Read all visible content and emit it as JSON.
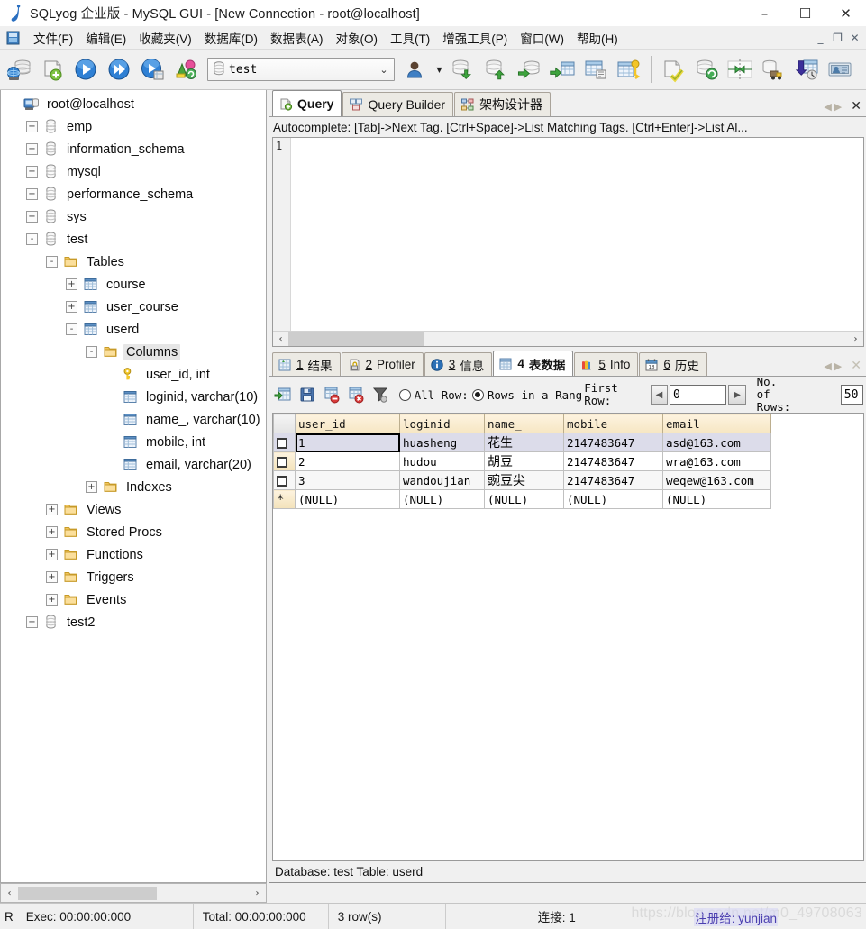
{
  "window": {
    "title": "SQLyog 企业版 - MySQL GUI - [New Connection - root@localhost]",
    "minimize": "–",
    "maximize": "☐",
    "close": "✕"
  },
  "menubar": {
    "items": [
      {
        "label": "文件(F)",
        "name": "menu-file"
      },
      {
        "label": "编辑(E)",
        "name": "menu-edit"
      },
      {
        "label": "收藏夹(V)",
        "name": "menu-favorites"
      },
      {
        "label": "数据库(D)",
        "name": "menu-database"
      },
      {
        "label": "数据表(A)",
        "name": "menu-table"
      },
      {
        "label": "对象(O)",
        "name": "menu-object"
      },
      {
        "label": "工具(T)",
        "name": "menu-tools"
      },
      {
        "label": "增强工具(P)",
        "name": "menu-powertools"
      },
      {
        "label": "窗口(W)",
        "name": "menu-window"
      },
      {
        "label": "帮助(H)",
        "name": "menu-help"
      }
    ],
    "mdi": {
      "minimize": "_",
      "restore": "❐",
      "close": "✕"
    }
  },
  "toolbar": {
    "database_selector_value": "test",
    "chevron": "⌄",
    "buttons": [
      {
        "name": "new-connection-icon"
      },
      {
        "name": "new-query-tab-icon"
      },
      {
        "name": "execute-query-icon"
      },
      {
        "name": "execute-all-queries-icon"
      },
      {
        "name": "execute-query-new-tab-icon"
      },
      {
        "name": "stop-query-icon"
      }
    ],
    "buttons2": [
      {
        "name": "user-manager-icon"
      },
      {
        "name": "backup-database-icon"
      },
      {
        "name": "restore-database-icon"
      },
      {
        "name": "import-external-data-icon"
      },
      {
        "name": "export-data-icon"
      },
      {
        "name": "table-data-export-icon"
      },
      {
        "name": "schema-key-icon"
      }
    ],
    "buttons3": [
      {
        "name": "query-builder-icon"
      },
      {
        "name": "sync-database-icon"
      },
      {
        "name": "schema-sync-icon"
      },
      {
        "name": "data-transfer-icon"
      },
      {
        "name": "scheduled-backup-icon"
      },
      {
        "name": "notifications-icon"
      }
    ]
  },
  "tree": {
    "root": "root@localhost",
    "nodes": [
      {
        "label": "root@localhost",
        "level": 0,
        "icon": "server-icon",
        "expander": "none"
      },
      {
        "label": "emp",
        "level": 1,
        "icon": "database-icon",
        "expander": "+"
      },
      {
        "label": "information_schema",
        "level": 1,
        "icon": "database-icon",
        "expander": "+"
      },
      {
        "label": "mysql",
        "level": 1,
        "icon": "database-icon",
        "expander": "+"
      },
      {
        "label": "performance_schema",
        "level": 1,
        "icon": "database-icon",
        "expander": "+"
      },
      {
        "label": "sys",
        "level": 1,
        "icon": "database-icon",
        "expander": "+"
      },
      {
        "label": "test",
        "level": 1,
        "icon": "database-icon",
        "expander": "-"
      },
      {
        "label": "Tables",
        "level": 2,
        "icon": "folder-icon",
        "expander": "-"
      },
      {
        "label": "course",
        "level": 3,
        "icon": "table-icon",
        "expander": "+"
      },
      {
        "label": "user_course",
        "level": 3,
        "icon": "table-icon",
        "expander": "+"
      },
      {
        "label": "userd",
        "level": 3,
        "icon": "table-icon",
        "expander": "-"
      },
      {
        "label": "Columns",
        "level": 4,
        "icon": "folder-icon",
        "expander": "-",
        "selected": true
      },
      {
        "label": "user_id, int",
        "level": 5,
        "icon": "primary-key-icon",
        "expander": "none"
      },
      {
        "label": "loginid, varchar(10)",
        "level": 5,
        "icon": "column-icon",
        "expander": "none"
      },
      {
        "label": "name_, varchar(10)",
        "level": 5,
        "icon": "column-icon",
        "expander": "none"
      },
      {
        "label": "mobile, int",
        "level": 5,
        "icon": "column-icon",
        "expander": "none"
      },
      {
        "label": "email, varchar(20)",
        "level": 5,
        "icon": "column-icon",
        "expander": "none"
      },
      {
        "label": "Indexes",
        "level": 4,
        "icon": "folder-icon",
        "expander": "+"
      },
      {
        "label": "Views",
        "level": 2,
        "icon": "folder-icon",
        "expander": "+"
      },
      {
        "label": "Stored Procs",
        "level": 2,
        "icon": "folder-icon",
        "expander": "+"
      },
      {
        "label": "Functions",
        "level": 2,
        "icon": "folder-icon",
        "expander": "+"
      },
      {
        "label": "Triggers",
        "level": 2,
        "icon": "folder-icon",
        "expander": "+"
      },
      {
        "label": "Events",
        "level": 2,
        "icon": "folder-icon",
        "expander": "+"
      },
      {
        "label": "test2",
        "level": 1,
        "icon": "database-icon",
        "expander": "+"
      }
    ]
  },
  "editor_tabs": {
    "tabs": [
      {
        "label": "Query",
        "icon": "query-icon",
        "active": true
      },
      {
        "label": "Query Builder",
        "icon": "query-builder-icon",
        "active": false
      },
      {
        "label": "架构设计器",
        "icon": "schema-designer-icon",
        "active": false
      }
    ],
    "prev_arrow": "◀",
    "next_arrow": "▶",
    "close": "✕"
  },
  "autocomplete_hint": "Autocomplete: [Tab]->Next Tag. [Ctrl+Space]->List Matching Tags. [Ctrl+Enter]->List Al...",
  "editor": {
    "line_number": "1",
    "content": ""
  },
  "result_tabs": {
    "tabs": [
      {
        "num": "1",
        "label": "结果",
        "icon": "result-grid-icon",
        "active": false
      },
      {
        "num": "2",
        "label": "Profiler",
        "icon": "profiler-icon",
        "active": false
      },
      {
        "num": "3",
        "label": "信息",
        "icon": "info-icon",
        "active": false
      },
      {
        "num": "4",
        "label": "表数据",
        "icon": "table-data-icon",
        "active": true
      },
      {
        "num": "5",
        "label": "Info",
        "icon": "table-info-icon",
        "active": false
      },
      {
        "num": "6",
        "label": "历史",
        "icon": "history-icon",
        "active": false
      }
    ],
    "prev_arrow": "◀",
    "next_arrow": "▶",
    "close": "✕"
  },
  "grid_toolbar": {
    "buttons": [
      {
        "name": "refresh-data-icon"
      },
      {
        "name": "save-changes-icon"
      },
      {
        "name": "discard-changes-icon"
      },
      {
        "name": "delete-row-icon"
      },
      {
        "name": "filter-icon"
      }
    ],
    "all_rows_label": "All Row:",
    "range_label": "Rows in a Rang",
    "all_rows_selected": false,
    "range_selected": true,
    "first_row_label": "First\nRow:",
    "first_row_value": "0",
    "left_arrow": "◀",
    "right_arrow": "▶",
    "no_of_rows_label": "No. of\nRows:",
    "no_of_rows_value": "50"
  },
  "grid": {
    "columns": [
      "user_id",
      "loginid",
      "name_",
      "mobile",
      "email"
    ],
    "rows": [
      {
        "selected": true,
        "cells": [
          "1",
          "huasheng",
          "花生",
          "2147483647",
          "asd@163.com"
        ]
      },
      {
        "selected": false,
        "cells": [
          "2",
          "hudou",
          "胡豆",
          "2147483647",
          "wra@163.com"
        ]
      },
      {
        "selected": false,
        "cells": [
          "3",
          "wandoujian",
          "豌豆尖",
          "2147483647",
          "weqew@163.com"
        ]
      }
    ],
    "new_row": {
      "marker": "*",
      "cells": [
        "(NULL)",
        "(NULL)",
        "(NULL)",
        "(NULL)",
        "(NULL)"
      ]
    }
  },
  "db_status": "Database: test Table: userd",
  "statusbar": {
    "indicator": "R",
    "exec": "Exec: 00:00:00:000",
    "total": "Total: 00:00:00:000",
    "rows": "3 row(s)",
    "connection": "连接: 1",
    "watermark": "https://blog.csdn.net/m0_49708063",
    "watermark_overlay": "注册给: yunjian"
  },
  "scroll": {
    "left_arrow": "‹",
    "right_arrow": "›"
  }
}
